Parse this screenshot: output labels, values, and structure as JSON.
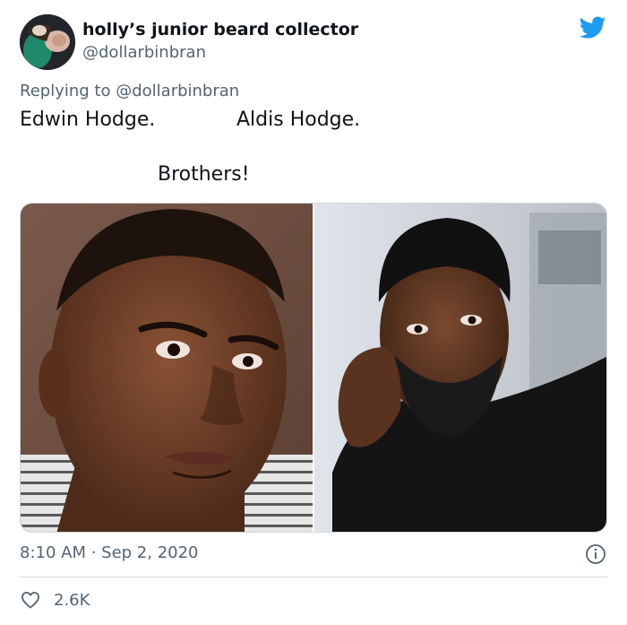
{
  "tweet": {
    "author_name": "holly’s junior beard collector",
    "author_handle": "@dollarbinbran",
    "reply_prefix": "Replying to",
    "reply_mention": "@dollarbinbran",
    "text_lines": [
      "Edwin Hodge.",
      "Aldis Hodge.",
      "Brothers!"
    ],
    "timestamp": "8:10 AM · Sep 2, 2020",
    "like_count": "2.6K"
  },
  "icons": {
    "brand": "twitter-bird-icon",
    "info": "info-icon",
    "like": "heart-icon"
  },
  "colors": {
    "brand_blue": "#1d9bf0",
    "text": "#0f1419",
    "secondary": "#536471",
    "border": "#cfd9de"
  }
}
